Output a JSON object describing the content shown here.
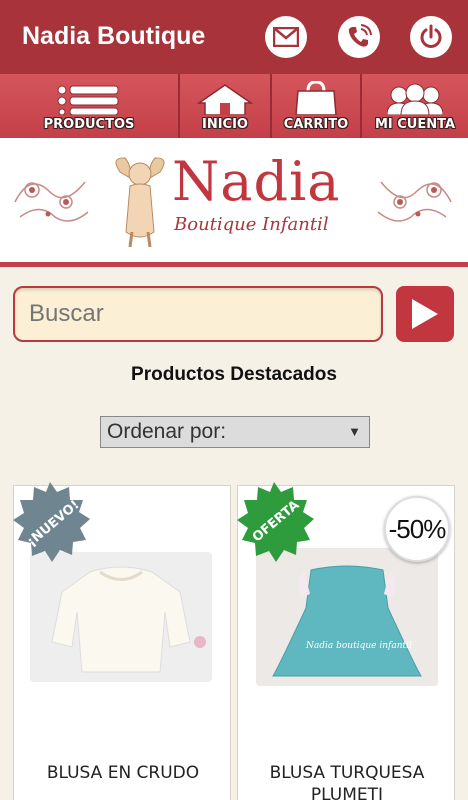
{
  "app": {
    "title": "Nadia Boutique"
  },
  "header_actions": [
    {
      "name": "mail-icon"
    },
    {
      "name": "phone-icon"
    },
    {
      "name": "power-icon"
    }
  ],
  "nav": {
    "items": [
      {
        "label": "PRODUCTOS",
        "icon": "menu-list-icon"
      },
      {
        "label": "INICIO",
        "icon": "home-icon"
      },
      {
        "label": "CARRITO",
        "icon": "shopping-bag-icon"
      },
      {
        "label": "MI CUENTA",
        "icon": "users-icon"
      }
    ]
  },
  "logo": {
    "main": "Nadia",
    "sub": "Boutique Infantil"
  },
  "search": {
    "placeholder": "Buscar"
  },
  "section": {
    "title": "Productos Destacados"
  },
  "sort": {
    "selected": "Ordenar por:"
  },
  "products": [
    {
      "name": "BLUSA EN CRUDO",
      "badge": "¡NUEVO!",
      "badge_color": "#6f8590"
    },
    {
      "name": "BLUSA TURQUESA PLUMETI",
      "badge": "OFERTA",
      "badge_color": "#2e9b3c",
      "discount": "-50%"
    }
  ],
  "colors": {
    "brand": "#a9333b",
    "accent": "#c2363f",
    "background": "#f6f1e6"
  }
}
